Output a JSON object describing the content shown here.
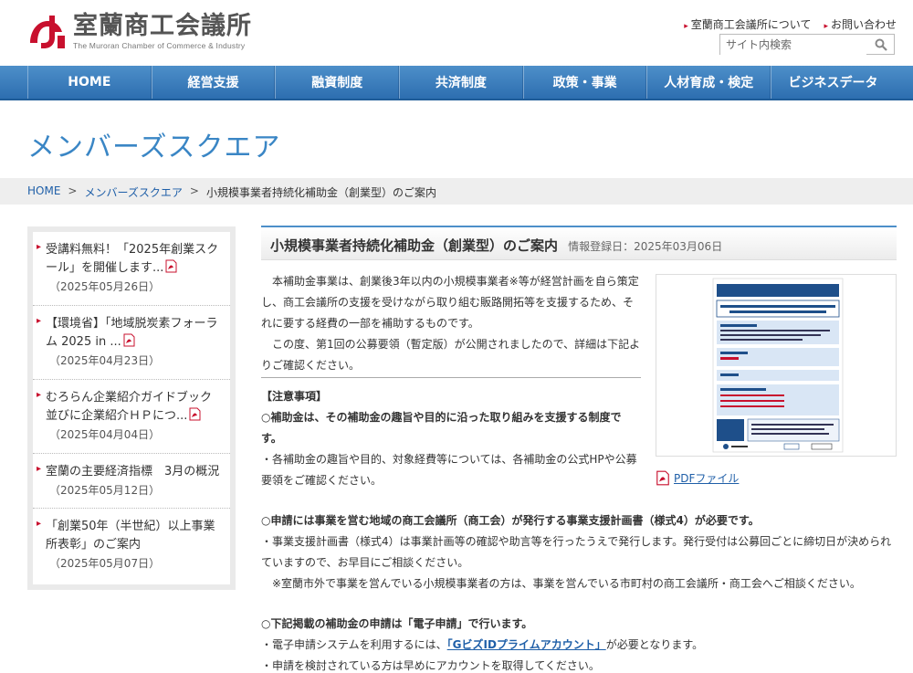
{
  "header": {
    "logo_jp": "室蘭商工会議所",
    "logo_en": "The Muroran Chamber of Commerce & Industry",
    "top_links": [
      "室蘭商工会議所について",
      "お問い合わせ"
    ],
    "search_placeholder": "サイト内検索"
  },
  "nav": {
    "items": [
      "HOME",
      "経営支援",
      "融資制度",
      "共済制度",
      "政策・事業",
      "人材育成・検定",
      "ビジネスデータ"
    ]
  },
  "page_title": "メンバーズスクエア",
  "breadcrumb": {
    "home": "HOME",
    "sep": ">",
    "section": "メンバーズスクエア",
    "current": "小規模事業者持続化補助金（創業型）のご案内"
  },
  "sidebar": {
    "items": [
      {
        "title": "受講料無料！「2025年創業スクール」を開催します...",
        "date": "（2025年05月26日）",
        "pdf": true
      },
      {
        "title": "【環境省】「地域脱炭素フォーラム 2025 in ...",
        "date": "（2025年04月23日）",
        "pdf": true
      },
      {
        "title": "むろらん企業紹介ガイドブック並びに企業紹介ＨＰにつ...",
        "date": "（2025年04月04日）",
        "pdf": true
      },
      {
        "title": "室蘭の主要経済指標　3月の概況",
        "date": "（2025年05月12日）",
        "pdf": false
      },
      {
        "title": "「創業50年（半世紀）以上事業所表彰」のご案内",
        "date": "（2025年05月07日）",
        "pdf": false
      }
    ]
  },
  "article": {
    "title": "小規模事業者持続化補助金（創業型）のご案内",
    "date": "情報登録日：2025年03月06日",
    "intro_1": "本補助金事業は、創業後3年以内の小規模事業者※等が経営計画を自ら策定し、商工会議所の支援を受けながら取り組む販路開拓等を支援するため、それに要する経費の一部を補助するものです。",
    "intro_2": "この度、第1回の公募要領（暫定版）が公開されましたので、詳細は下記よりご確認ください。",
    "pdf_label": "PDFファイル",
    "notes_heading": "【注意事項】",
    "note1_head": "○補助金は、その補助金の趣旨や目的に沿った取り組みを支援する制度です。",
    "note1_body": "・各補助金の趣旨や目的、対象経費等については、各補助金の公式HPや公募要領をご確認ください。",
    "note2_head": "○申請には事業を営む地域の商工会議所（商工会）が発行する事業支援計画書（様式4）が必要です。",
    "note2_body": "・事業支援計画書（様式4）は事業計画等の確認や助言等を行ったうえで発行します。発行受付は公募回ごとに締切日が決められていますので、お早目にご相談ください。",
    "note2_sub": "※室蘭市外で事業を営んでいる小規模事業者の方は、事業を営んでいる市町村の商工会議所・商工会へご相談ください。",
    "note3_head": "○下記掲載の補助金の申請は「電子申請」で行います。",
    "note3_body_pre": "・電子申請システムを利用するには、",
    "note3_link": "「GビズIDプライムアカウント」",
    "note3_body_post": "が必要となります。",
    "note3_body2": "・申請を検討されている方は早めにアカウントを取得してください。"
  },
  "colors": {
    "accent": "#3a86c5",
    "nav": "#2d6eb0",
    "logo_red": "#c8102e",
    "link": "#1f5fa8"
  }
}
